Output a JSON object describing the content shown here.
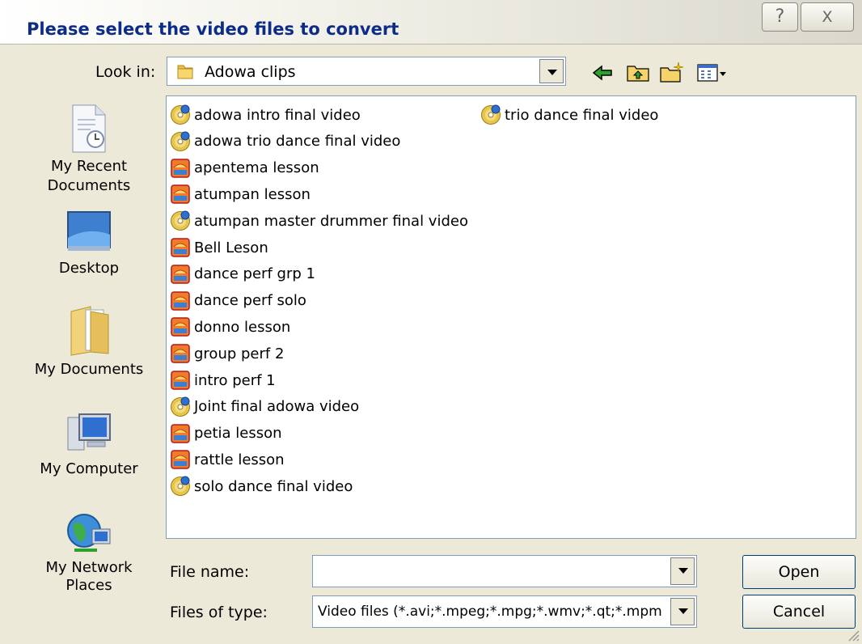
{
  "dialog": {
    "title": "Please select the video files to convert",
    "help_button": "?",
    "close_button": "X"
  },
  "toolbar": {
    "look_in_label": "Look in:",
    "look_in_value": "Adowa clips",
    "icons": [
      "back-arrow-icon",
      "up-folder-icon",
      "new-folder-icon",
      "view-menu-icon"
    ]
  },
  "places": [
    {
      "label_line1": "My Recent",
      "label_line2": "Documents",
      "icon": "recent-documents-icon"
    },
    {
      "label_line1": "Desktop",
      "label_line2": "",
      "icon": "desktop-icon"
    },
    {
      "label_line1": "My Documents",
      "label_line2": "",
      "icon": "my-documents-icon"
    },
    {
      "label_line1": "My Computer",
      "label_line2": "",
      "icon": "my-computer-icon"
    },
    {
      "label_line1": "My Network",
      "label_line2": "Places",
      "icon": "my-network-places-icon"
    }
  ],
  "files": [
    {
      "name": "adowa intro final video",
      "type": "dvd"
    },
    {
      "name": "adowa trio dance final video",
      "type": "dvd"
    },
    {
      "name": "apentema lesson",
      "type": "video"
    },
    {
      "name": "atumpan lesson",
      "type": "video"
    },
    {
      "name": "atumpan master drummer final video",
      "type": "dvd"
    },
    {
      "name": "Bell Leson",
      "type": "video"
    },
    {
      "name": "dance perf grp 1",
      "type": "video"
    },
    {
      "name": "dance perf solo",
      "type": "video"
    },
    {
      "name": "donno lesson",
      "type": "video"
    },
    {
      "name": "group perf 2",
      "type": "video"
    },
    {
      "name": "intro perf 1",
      "type": "video"
    },
    {
      "name": "Joint final adowa video",
      "type": "dvd"
    },
    {
      "name": "petia lesson",
      "type": "video"
    },
    {
      "name": "rattle lesson",
      "type": "video"
    },
    {
      "name": "solo dance final video",
      "type": "dvd"
    },
    {
      "name": "trio dance final video",
      "type": "dvd"
    }
  ],
  "bottom": {
    "file_name_label": "File name:",
    "file_name_value": "",
    "files_of_type_label": "Files of type:",
    "files_of_type_value": "Video files (*.avi;*.mpeg;*.mpg;*.wmv;*.qt;*.mpm",
    "open_label": "Open",
    "cancel_label": "Cancel"
  }
}
